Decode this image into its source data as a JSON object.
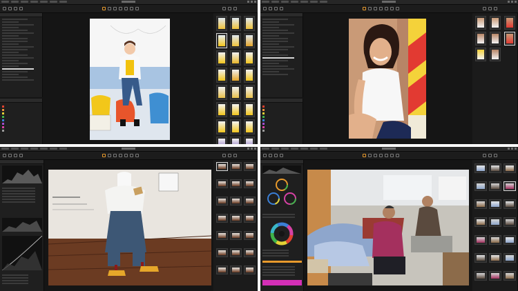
{
  "screens": [
    {
      "id": "top-left",
      "photo_subject": "",
      "selected_thumbnail": 3
    },
    {
      "id": "top-right",
      "photo_subject": "",
      "selected_thumbnail": 5
    },
    {
      "id": "bottom-left",
      "photo_subject": "",
      "selected_thumbnail": 0
    },
    {
      "id": "bottom-right",
      "photo_subject": "",
      "selected_thumbnail": 5
    }
  ],
  "colors": {
    "window_bg": "#151515",
    "panel_bg": "#1f1f1f",
    "accent_orange": "#e89a2c",
    "accent_magenta": "#d42fb6",
    "selection": "#d8d8d8"
  },
  "icons": [
    "cursor-icon",
    "crop-icon",
    "rotate-icon",
    "brush-icon",
    "eraser-icon",
    "picker-icon",
    "zoom-icon",
    "grid-icon",
    "compare-icon"
  ],
  "label_swatches": [
    "#e0412f",
    "#e8903a",
    "#e4d235",
    "#3fb34a",
    "#3a7fd6",
    "#a34bd1",
    "#d642a4",
    "#9a9a9a"
  ]
}
